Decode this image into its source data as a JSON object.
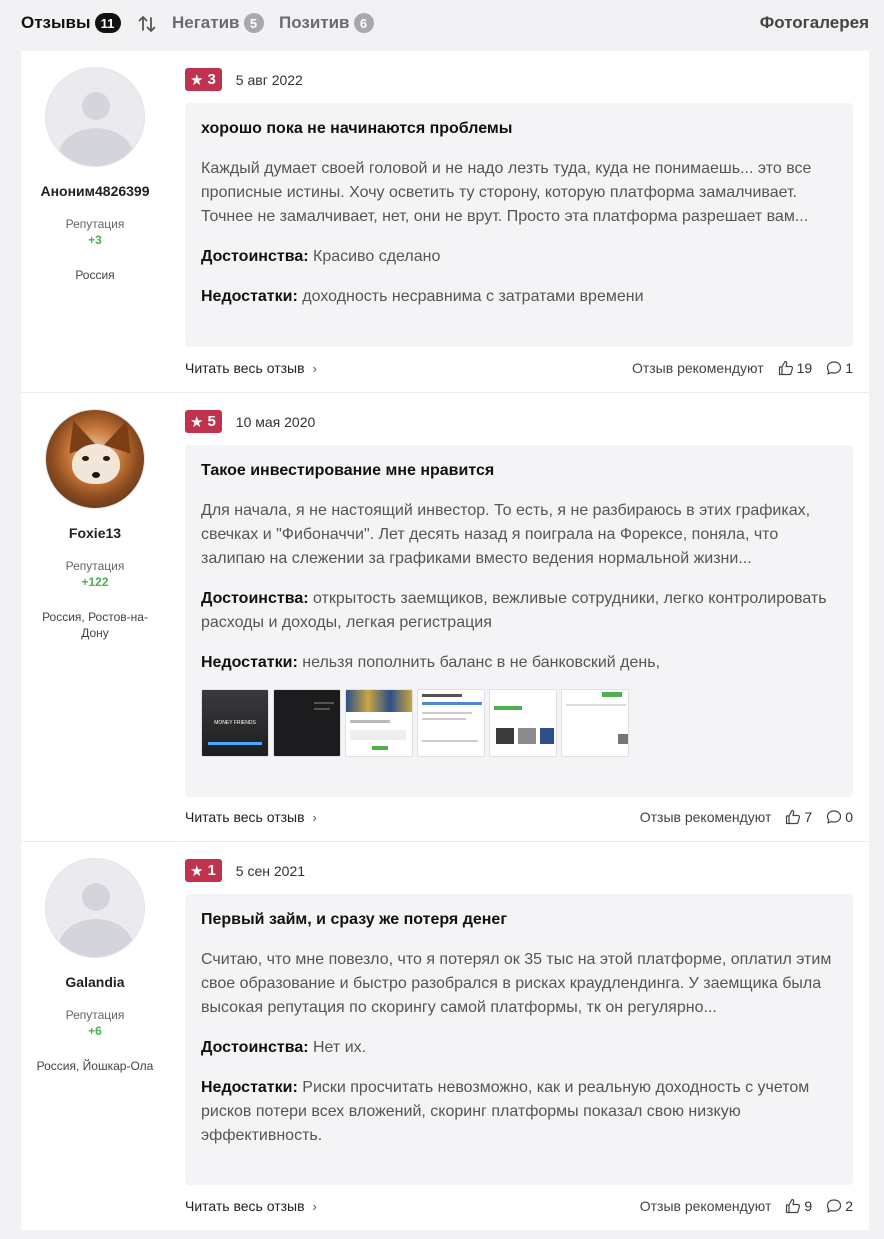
{
  "tabs": {
    "reviews": {
      "label": "Отзывы",
      "count": "11"
    },
    "negative": {
      "label": "Негатив",
      "count": "5"
    },
    "positive": {
      "label": "Позитив",
      "count": "6"
    },
    "gallery": "Фотогалерея"
  },
  "labels": {
    "reputation": "Репутация",
    "pros": "Достоинства:",
    "cons": "Недостатки:",
    "read_more": "Читать весь отзыв",
    "recommend": "Отзыв рекомендуют"
  },
  "reviews": [
    {
      "author": "Аноним4826399",
      "reputation": "+3",
      "location": "Россия",
      "rating": "3",
      "date": "5 авг 2022",
      "title": "хорошо пока не начинаются проблемы",
      "text": "Каждый думает своей головой и не надо лезть туда, куда не понимаешь... это все прописные истины. Хочу осветить ту сторону, которую платформа замалчивает. Точнее не замалчивает, нет, они не врут. Просто эта платформа разрешает вам...",
      "pros": "Красиво сделано",
      "cons": "доходность несравнима с затратами времени",
      "likes": "19",
      "comments": "1"
    },
    {
      "author": "Foxie13",
      "reputation": "+122",
      "location": "Россия, Ростов-на-Дону",
      "rating": "5",
      "date": "10 мая 2020",
      "title": "Такое инвестирование мне нравится",
      "text": "Для начала, я не настоящий инвестор. То есть, я не разбираюсь в этих графиках, свечках и \"Фибоначчи\". Лет десять назад я поиграла на Форексе, поняла, что залипаю на слежении за графиками вместо ведения нормальной жизни...",
      "pros": "открытость заемщиков, вежливые сотрудники, легко контролировать расходы и доходы, легкая регистрация",
      "cons": "нельзя пополнить баланс в не банковский день,",
      "thumb_caption": "MONEY FRIENDS",
      "likes": "7",
      "comments": "0"
    },
    {
      "author": "Galandia",
      "reputation": "+6",
      "location": "Россия, Йошкар-Ола",
      "rating": "1",
      "date": "5 сен 2021",
      "title": "Первый займ, и сразу же потеря денег",
      "text": "Считаю, что мне повезло, что я потерял ок 35 тыс на этой платформе, оплатил этим свое образование и быстро разобрался в рисках краудлендинга. У заемщика была высокая репутация по скорингу самой платформы, тк он регулярно...",
      "pros": "Нет их.",
      "cons": "Риски просчитать невозможно, как и реальную доходность с учетом рисков потери всех вложений, скоринг платформы показал свою низкую эффективность.",
      "likes": "9",
      "comments": "2"
    }
  ]
}
